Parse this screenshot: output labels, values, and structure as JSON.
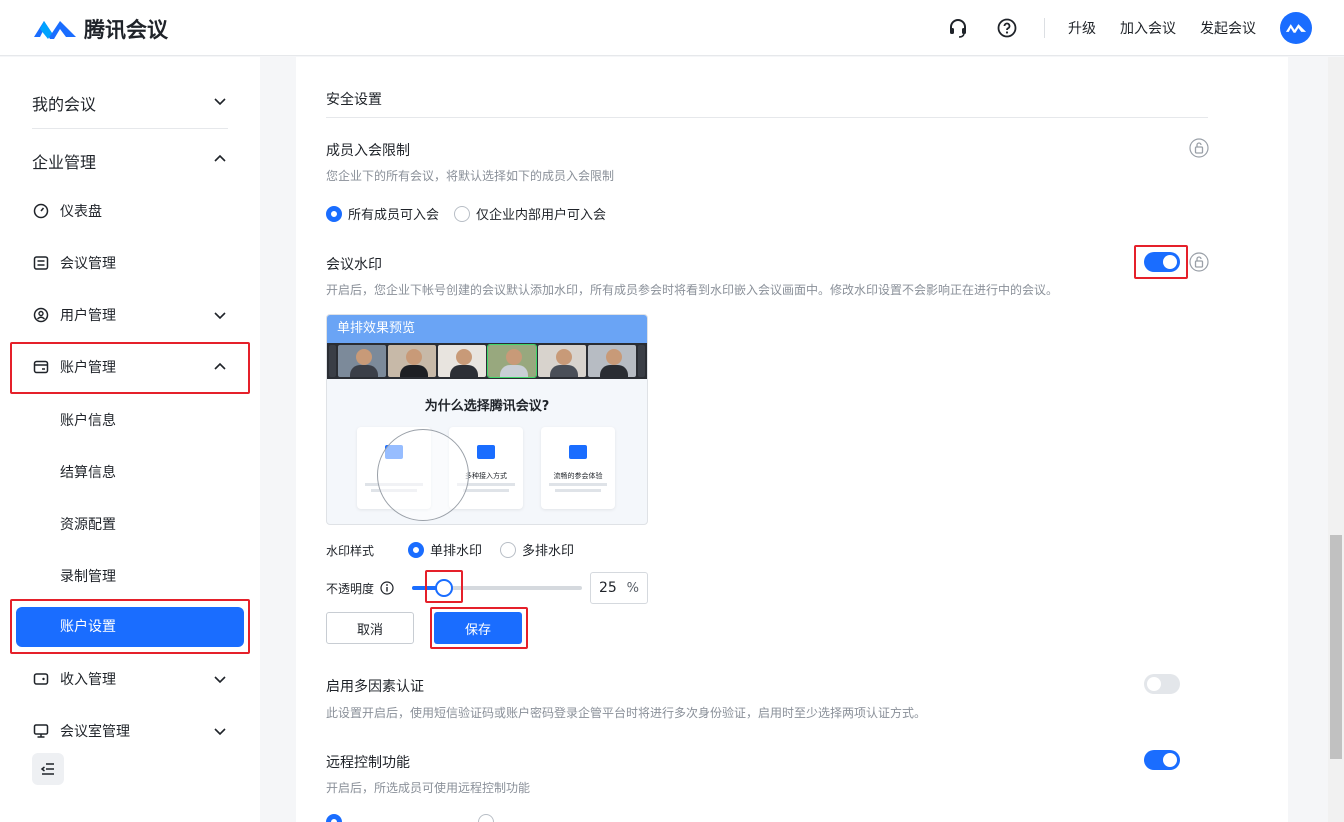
{
  "header": {
    "brand": "腾讯会议",
    "links": [
      "升级",
      "加入会议",
      "发起会议"
    ],
    "icons": [
      "headset-icon",
      "help-icon"
    ],
    "accent": "#1a6dff"
  },
  "sidebar": {
    "my_meetings": "我的会议",
    "enterprise": "企业管理",
    "items": [
      {
        "label": "仪表盘",
        "icon": "dashboard-icon"
      },
      {
        "label": "会议管理",
        "icon": "list-icon"
      },
      {
        "label": "用户管理",
        "icon": "user-icon"
      },
      {
        "label": "账户管理",
        "icon": "account-icon"
      }
    ],
    "sub_items": [
      "账户信息",
      "结算信息",
      "资源配置",
      "录制管理"
    ],
    "active_item": "账户设置",
    "more_items": [
      {
        "label": "收入管理",
        "icon": "wallet-icon"
      },
      {
        "label": "会议室管理",
        "icon": "room-icon"
      }
    ]
  },
  "content": {
    "section_title": "安全设置",
    "join_limit": {
      "title": "成员入会限制",
      "desc": "您企业下的所有会议，将默认选择如下的成员入会限制",
      "options": [
        "所有成员可入会",
        "仅企业内部用户可入会"
      ]
    },
    "watermark": {
      "title": "会议水印",
      "desc": "开启后，您企业下帐号创建的会议默认添加水印，所有成员参会时将看到水印嵌入会议画面中。修改水印设置不会影响正在进行中的会议。",
      "enabled": true,
      "preview_title": "单排效果预览",
      "preview_heading": "为什么选择腾讯会议?",
      "preview_features": [
        "多种接入方式",
        "流畅的参会体验"
      ],
      "style_label": "水印样式",
      "style_options": [
        "单排水印",
        "多排水印"
      ],
      "opacity_label": "不透明度",
      "opacity_value": "25",
      "opacity_unit": "%",
      "opacity_fraction": 0.25,
      "cancel": "取消",
      "save": "保存"
    },
    "mfa": {
      "title": "启用多因素认证",
      "desc": "此设置开启后，使用短信验证码或账户密码登录企管平台时将进行多次身份验证，启用时至少选择两项认证方式。",
      "enabled": false
    },
    "remote": {
      "title": "远程控制功能",
      "desc": "开启后，所选成员可使用远程控制功能",
      "enabled": true
    }
  }
}
